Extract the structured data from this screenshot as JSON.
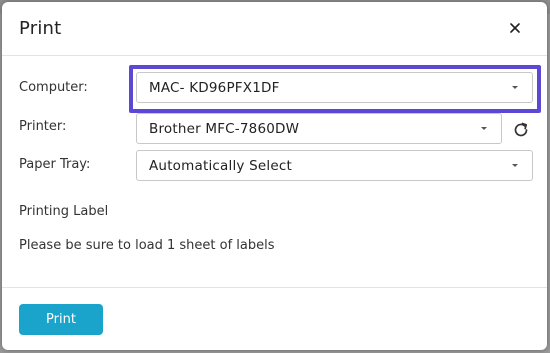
{
  "dialog": {
    "title": "Print",
    "close_icon": "close-icon"
  },
  "form": {
    "computer": {
      "label": "Computer:",
      "value": "MAC- KD96PFX1DF"
    },
    "printer": {
      "label": "Printer:",
      "value": "Brother MFC-7860DW",
      "refresh_icon": "refresh-icon"
    },
    "paper_tray": {
      "label": "Paper Tray:",
      "value": "Automatically Select"
    }
  },
  "info": {
    "heading": "Printing Label",
    "message": "Please be sure to load 1 sheet of labels"
  },
  "footer": {
    "print_label": "Print"
  },
  "colors": {
    "accent": "#1aa3cb",
    "highlight": "#5b48d4",
    "backdrop": "#9a9a9a"
  }
}
